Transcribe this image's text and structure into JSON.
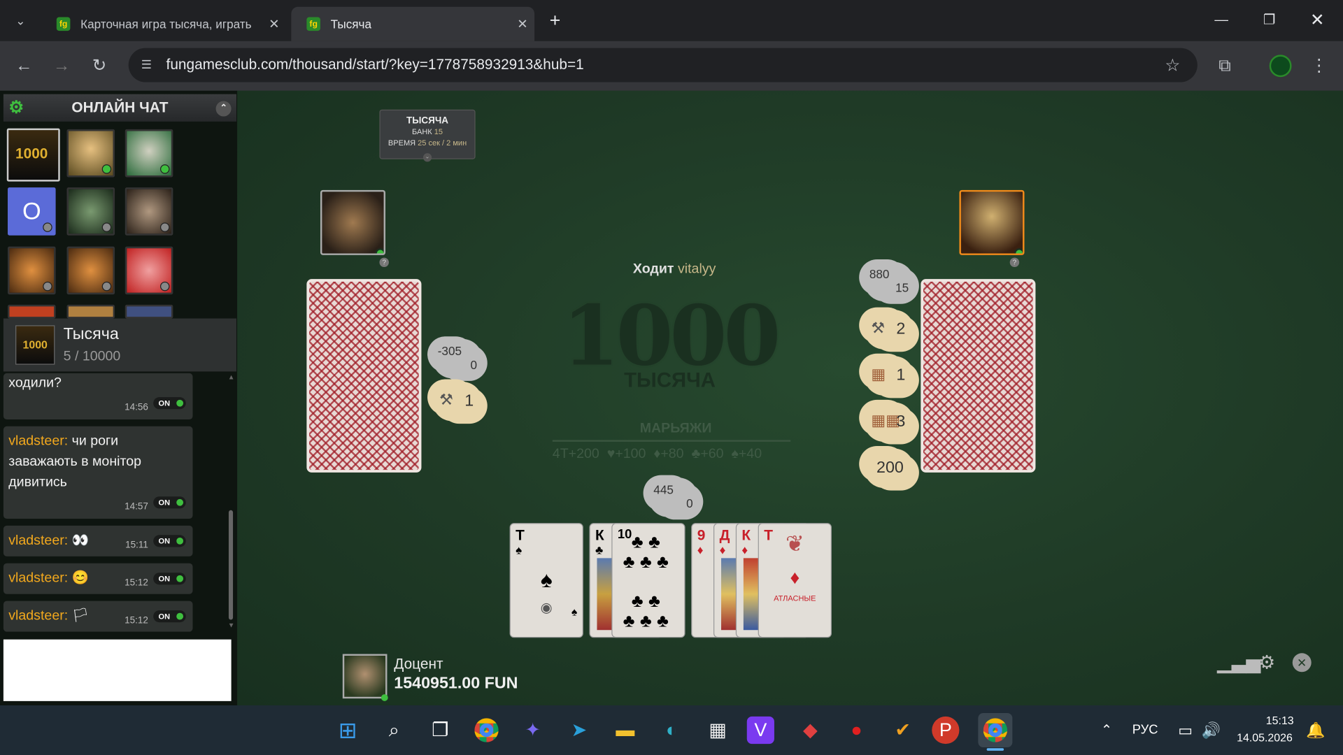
{
  "browser": {
    "tabs": [
      {
        "title": "Карточная игра тысяча, играть"
      },
      {
        "title": "Тысяча"
      }
    ],
    "url": "fungamesclub.com/thousand/start/?key=1778758932913&hub=1"
  },
  "chat": {
    "title": "ОНЛАЙН ЧАТ",
    "avatar_letter": "О",
    "room_name": "Тысяча",
    "room_count": "5 / 10000",
    "messages": [
      {
        "user": "",
        "text": "ходили?",
        "time": "14:56",
        "toggle": "ON"
      },
      {
        "user": "vladsteer:",
        "text": "чи роги заважають в монітор дивитись",
        "time": "14:57",
        "toggle": "ON"
      },
      {
        "user": "vladsteer:",
        "text": "👀",
        "time": "15:11",
        "toggle": "ON"
      },
      {
        "user": "vladsteer:",
        "text": "😊",
        "time": "15:12",
        "toggle": "ON"
      },
      {
        "user": "vladsteer:",
        "text": "🏳",
        "time": "15:12",
        "toggle": "ON"
      }
    ]
  },
  "game": {
    "info": {
      "title": "ТЫСЯЧА",
      "bank_label": "БАНК",
      "bank": "15",
      "time_label": "ВРЕМЯ",
      "time": "25 сек / 2 мин"
    },
    "turn_label": "Ходит",
    "turn_player": "vitalyy",
    "logo_number": "1000",
    "logo_text": "ТЫСЯЧА",
    "marriage_title": "МАРЬЯЖИ",
    "marriages": [
      "4Т+200",
      "♥+100",
      "♦+80",
      "♣+60",
      "♠+40"
    ],
    "left_player": {
      "score": "-305",
      "sub": "0",
      "bolts": "1"
    },
    "right_player": {
      "score": "880",
      "sub": "15",
      "bolts": "2",
      "barrels_a": "1",
      "barrels_b": "3",
      "bid": "200"
    },
    "me": {
      "score": "445",
      "sub": "0",
      "name": "Доцент",
      "money": "1540951.00 FUN"
    },
    "hand": [
      {
        "rank": "Т",
        "suit": "♠",
        "color": "#222"
      },
      {
        "rank": "К",
        "suit": "♣",
        "color": "#222"
      },
      {
        "rank": "10",
        "suit": "♣",
        "color": "#222"
      },
      {
        "rank": "9",
        "suit": "♦",
        "color": "#c8202a"
      },
      {
        "rank": "Д",
        "suit": "♦",
        "color": "#c8202a"
      },
      {
        "rank": "К",
        "suit": "♦",
        "color": "#c8202a"
      },
      {
        "rank": "Т",
        "suit": "♦",
        "color": "#c8202a",
        "caption": "АТЛАСНЫЕ"
      }
    ]
  },
  "taskbar": {
    "lang": "РУС",
    "time": "15:13",
    "date": "14.05.2026"
  },
  "colors": {
    "accent": "#f2a81d",
    "online": "#3fbf3f",
    "table": "#1f3a26"
  }
}
